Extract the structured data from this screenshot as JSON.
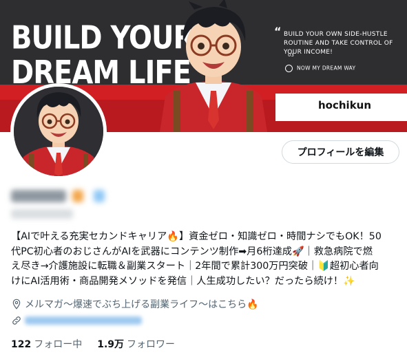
{
  "banner": {
    "headline": "BUILD YOUR\nDREAM LIFE",
    "quote_mark": "“",
    "tagline": "BUILD YOUR OWN SIDE-HUSTLE ROUTINE AND TAKE CONTROL OF YOUR INCOME!",
    "dots": "03",
    "now_way": "NOW MY DREAM WAY",
    "handle": "hochikun"
  },
  "edit_profile_label": "プロフィールを編集",
  "bio_lines": [
    "【AIで叶える充実セカンドキャリア🔥】資金ゼロ・知識ゼロ・時間ナシでもOK！50",
    "代PC初心者のおじさんがAIを武器にコンテンツ制作➡月6桁達成🚀｜救急病院で燃",
    "え尽き→介護施設に転職＆副業スタート｜2年間で累計300万円突破｜🔰超初心者向",
    "けにAI活用術・商品開発メソッドを発信｜人生成功したい？だったら続け！✨"
  ],
  "location_text": "メルマガ～爆速でぶち上げる副業ライフ～はこちら🔥",
  "following": {
    "count": "122",
    "label": "フォロー中"
  },
  "followers": {
    "count": "1.9万",
    "label": "フォロワー"
  },
  "colors": {
    "banner_dark": "#2e2e31",
    "banner_red": "#d21f24",
    "link": "#1d9bf0",
    "muted": "#536471"
  },
  "icons": [
    "location-icon",
    "link-icon",
    "verified-badge-icon"
  ]
}
